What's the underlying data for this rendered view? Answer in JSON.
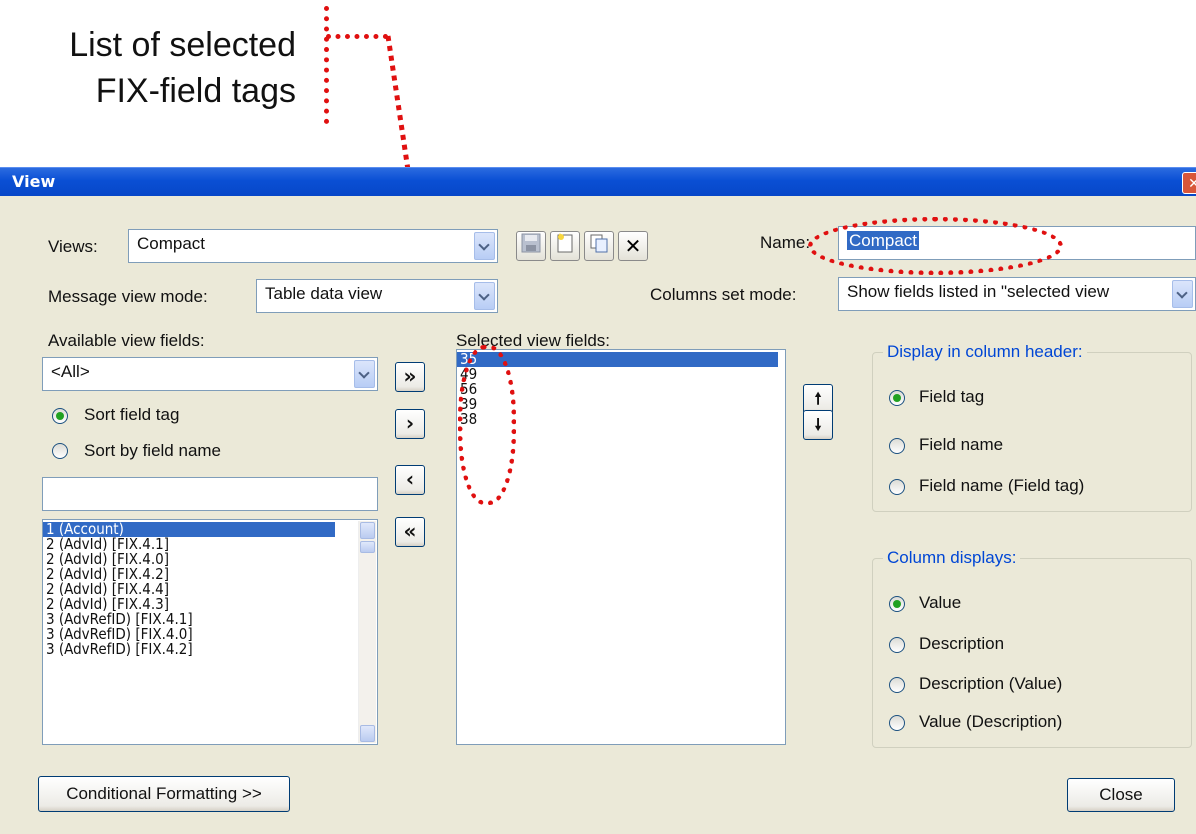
{
  "callout": {
    "line1": "List of selected",
    "line2": "FIX-field tags"
  },
  "window": {
    "title": "View",
    "close_glyph": "✕"
  },
  "views": {
    "label": "Views:",
    "value": "Compact"
  },
  "toolbar": {
    "save_icon": "save-icon",
    "new_icon": "new-document-icon",
    "copy_icon": "copy-icon",
    "delete_icon": "delete-icon",
    "delete_glyph": "✕"
  },
  "name": {
    "label": "Name:",
    "value": "Compact"
  },
  "message_view_mode": {
    "label": "Message view mode:",
    "value": "Table data view"
  },
  "columns_set_mode": {
    "label": "Columns set mode:",
    "value": "Show fields listed in \"selected view"
  },
  "available": {
    "label": "Available view fields:",
    "filter_value": "<All>",
    "sort_tag_label": "Sort field tag",
    "sort_name_label": "Sort by field name",
    "search_value": "",
    "items": [
      "1 (Account)",
      "2 (AdvId) [FIX.4.1]",
      "2 (AdvId) [FIX.4.0]",
      "2 (AdvId) [FIX.4.2]",
      "2 (AdvId) [FIX.4.4]",
      "2 (AdvId) [FIX.4.3]",
      "3 (AdvRefID) [FIX.4.1]",
      "3 (AdvRefID) [FIX.4.0]",
      "3 (AdvRefID) [FIX.4.2]"
    ]
  },
  "transfer": {
    "add_all": "»",
    "add": "›",
    "remove": "‹",
    "remove_all": "«"
  },
  "selected": {
    "label": "Selected view fields:",
    "items": [
      "35",
      "49",
      "56",
      "39",
      "38"
    ]
  },
  "order": {
    "up": "🠕",
    "down": "🠗"
  },
  "display_header": {
    "title": "Display in column header:",
    "options": [
      "Field tag",
      "Field name",
      "Field name (Field tag)"
    ]
  },
  "column_displays": {
    "title": "Column displays:",
    "options": [
      "Value",
      "Description",
      "Description (Value)",
      "Value (Description)"
    ]
  },
  "buttons": {
    "conditional": "Conditional Formatting >>",
    "close": "Close"
  },
  "colors": {
    "highlight": "#e01010",
    "selection": "#316ac5",
    "titlebar": "#0a4fd4"
  }
}
